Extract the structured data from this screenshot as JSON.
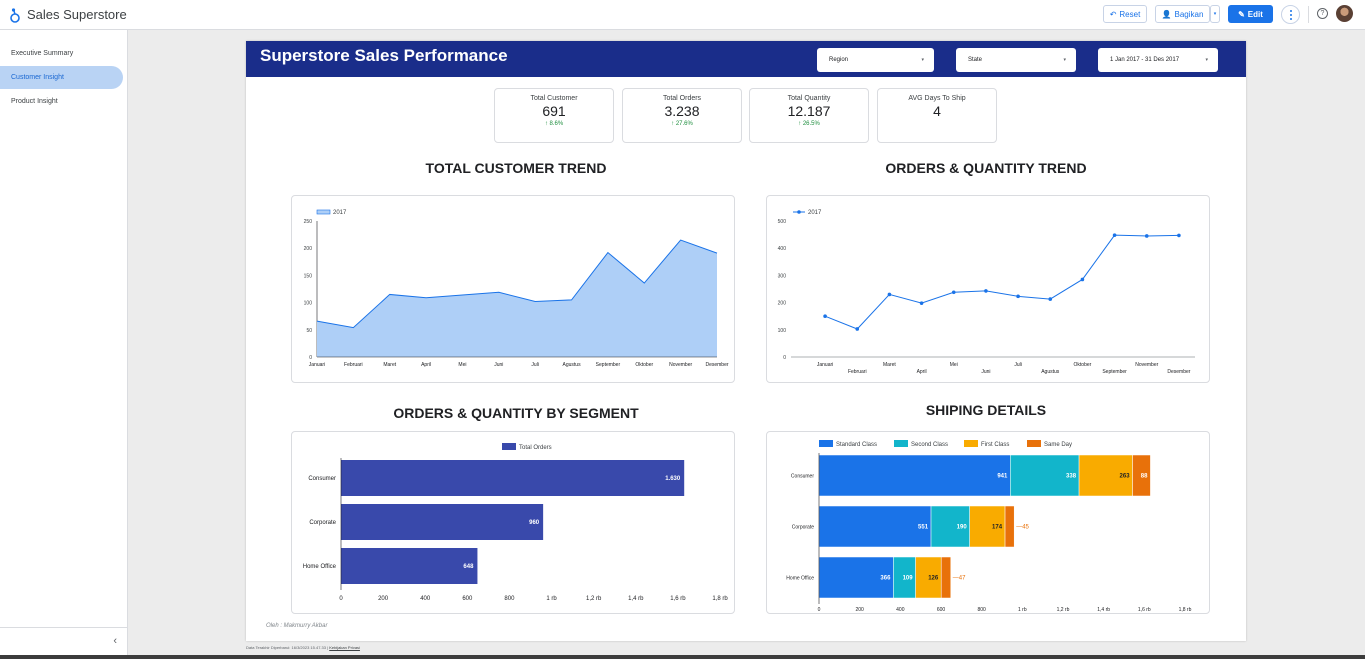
{
  "app": {
    "title": "Sales Superstore"
  },
  "toolbar": {
    "reset_label": "Reset",
    "share_label": "Bagikan",
    "edit_label": "Edit",
    "help_label": "?"
  },
  "sidebar": {
    "items": [
      {
        "label": "Executive Summary",
        "active": false
      },
      {
        "label": "Customer Insight",
        "active": true
      },
      {
        "label": "Product Insight",
        "active": false
      }
    ],
    "collapse_label": "‹"
  },
  "report": {
    "title": "Superstore Sales Performance",
    "filters": [
      {
        "label": "Region"
      },
      {
        "label": "State"
      },
      {
        "label": "1 Jan 2017 - 31 Des 2017"
      }
    ],
    "caret": "▾",
    "kpis": [
      {
        "label": "Total Customer",
        "value": "691",
        "delta": "↑ 8.6%"
      },
      {
        "label": "Total Orders",
        "value": "3.238",
        "delta": "↑ 27.6%"
      },
      {
        "label": "Total Quantity",
        "value": "12.187",
        "delta": "↑ 26.5%"
      },
      {
        "label": "AVG Days To Ship",
        "value": "4",
        "delta": ""
      }
    ],
    "sections": {
      "customer_trend": "TOTAL CUSTOMER  TREND",
      "orders_trend": "ORDERS & QUANTITY TREND",
      "segment": "ORDERS & QUANTITY BY SEGMENT",
      "shipping": "SHIPING DETAILS"
    },
    "credit": "Oleh : Makmurry Akbar"
  },
  "footer": {
    "text": "Data Terakhir Diperbarui: 16/3/2023 15.47.33  |  ",
    "link": "Kebijakan Privasi"
  },
  "colors": {
    "banner": "#1a2d8a",
    "area_fill": "#aecff7",
    "area_line": "#1a73e8",
    "bar": "#3949ab",
    "standard": "#1a73e8",
    "second": "#12b5cb",
    "first": "#f9ab00",
    "sameday": "#e8710a"
  },
  "chart_data": [
    {
      "id": "customer_trend",
      "type": "area",
      "legend": [
        "2017"
      ],
      "categories": [
        "Januari",
        "Februari",
        "Maret",
        "April",
        "Mei",
        "Juni",
        "Juli",
        "Agustus",
        "September",
        "Oktober",
        "November",
        "Desember"
      ],
      "series": [
        {
          "name": "2017",
          "values": [
            66,
            54,
            115,
            109,
            114,
            119,
            102,
            105,
            192,
            136,
            215,
            191
          ]
        }
      ],
      "ylim": [
        0,
        250
      ],
      "yticks": [
        0,
        50,
        100,
        150,
        200,
        250
      ]
    },
    {
      "id": "orders_trend",
      "type": "line",
      "legend": [
        "2017"
      ],
      "categories": [
        "Januari",
        "Februari",
        "Maret",
        "April",
        "Mei",
        "Juni",
        "Juli",
        "Agustus",
        "Oktober",
        "September",
        "November",
        "Desember"
      ],
      "series": [
        {
          "name": "2017",
          "values": [
            150,
            103,
            230,
            198,
            238,
            243,
            223,
            213,
            285,
            448,
            445,
            447
          ]
        }
      ],
      "ylim": [
        0,
        500
      ],
      "yticks": [
        0,
        100,
        200,
        300,
        400,
        500
      ]
    },
    {
      "id": "segment",
      "type": "bar",
      "orientation": "horizontal",
      "legend": [
        "Total Orders"
      ],
      "categories": [
        "Consumer",
        "Corporate",
        "Home Office"
      ],
      "series": [
        {
          "name": "Total Orders",
          "values": [
            1630,
            960,
            648
          ],
          "labels": [
            "1.630",
            "960",
            "648"
          ]
        }
      ],
      "xlim": [
        0,
        1800
      ],
      "xticks": [
        "0",
        "200",
        "400",
        "600",
        "800",
        "1 rb",
        "1,2 rb",
        "1,4 rb",
        "1,6 rb",
        "1,8 rb"
      ]
    },
    {
      "id": "shipping",
      "type": "bar",
      "orientation": "horizontal",
      "stacked": true,
      "categories": [
        "Consumer",
        "Corporate",
        "Home Office"
      ],
      "series": [
        {
          "name": "Standard Class",
          "values": [
            941,
            551,
            366
          ]
        },
        {
          "name": "Second Class",
          "values": [
            338,
            190,
            109
          ]
        },
        {
          "name": "First Class",
          "values": [
            263,
            174,
            126
          ]
        },
        {
          "name": "Same Day",
          "values": [
            88,
            45,
            47
          ]
        }
      ],
      "xlim": [
        0,
        1800
      ],
      "xticks": [
        "0",
        "200",
        "400",
        "600",
        "800",
        "1 rb",
        "1,2 rb",
        "1,4 rb",
        "1,6 rb",
        "1,8 rb"
      ]
    }
  ]
}
